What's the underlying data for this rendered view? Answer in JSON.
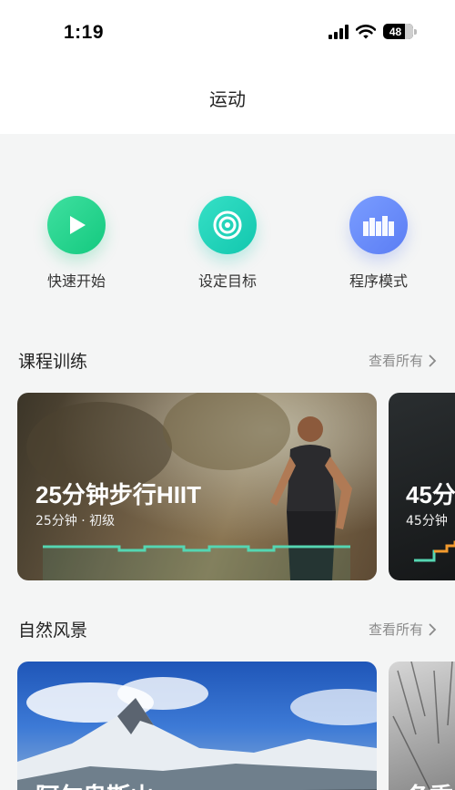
{
  "status": {
    "time": "1:19",
    "battery": "48"
  },
  "header": {
    "title": "运动"
  },
  "actions": [
    {
      "label": "快速开始",
      "icon": "play-icon"
    },
    {
      "label": "设定目标",
      "icon": "target-icon"
    },
    {
      "label": "程序模式",
      "icon": "program-bars-icon"
    }
  ],
  "courses": {
    "title": "课程训练",
    "see_all": "查看所有",
    "cards": [
      {
        "title": "25分钟步行HIIT",
        "subtitle": "25分钟 · 初级"
      },
      {
        "title": "45分",
        "subtitle": "45分钟"
      }
    ]
  },
  "scenery": {
    "title": "自然风景",
    "see_all": "查看所有",
    "cards": [
      {
        "title": "阿尔卑斯山"
      },
      {
        "title": "冬季"
      }
    ]
  },
  "colors": {
    "green": "#1ccf88",
    "teal": "#1ccdb4",
    "blue": "#6889f8",
    "chart_line": "#55d6b2",
    "chart_orange": "#f29a2e"
  }
}
